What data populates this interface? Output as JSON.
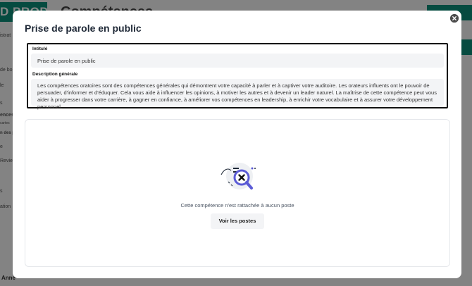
{
  "background": {
    "logo_text": "D PROD",
    "page_title": "Compétences",
    "sidebar_items": [
      "istrat",
      "de bo",
      "le",
      "s",
      "ences",
      "cartes",
      "n des p",
      "e",
      "Reviews",
      "s",
      "ation"
    ],
    "bottom_user": "Anne"
  },
  "modal": {
    "title": "Prise de parole en public",
    "close_icon": "close-circle-icon",
    "fields": {
      "title_label": "Intitulé",
      "title_value": "Prise de parole en public",
      "description_label": "Description générale",
      "description_value": "Les compétences oratoires sont des compétences générales qui démontrent votre capacité à parler et à captiver votre auditoire. Les orateurs influents ont le pouvoir de persuader, d'informer et d'éduquer. Cela vous aide à influencer les opinions, à motiver les autres et à devenir un leader naturel. La maîtrise de cette compétence peut vous aider à progresser dans votre carrière, à gagner en confiance, à améliorer vos compétences en leadership, à enrichir votre vocabulaire et à assurer votre développement personnel."
    },
    "empty_state": {
      "illustration": "magnifier-no-results-icon",
      "message": "Cette compétence n'est rattachée à aucun poste",
      "button_label": "Voir les postes"
    }
  },
  "colors": {
    "brand": "#0d8f7a",
    "overlay": "rgba(0,0,0,0.47)"
  }
}
